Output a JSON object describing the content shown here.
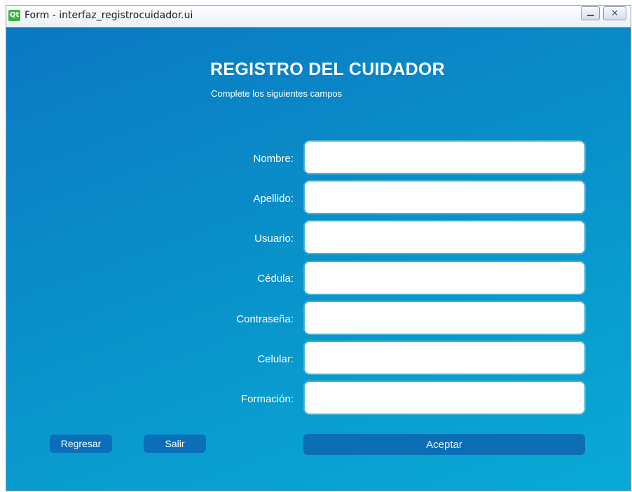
{
  "window": {
    "app_icon": "Qt",
    "title": "Form - interfaz_registrocuidador.ui"
  },
  "form": {
    "heading": "REGISTRO DEL CUIDADOR",
    "subheading": "Complete los siguientes campos",
    "fields": [
      {
        "label": "Nombre:",
        "value": ""
      },
      {
        "label": "Apellido:",
        "value": ""
      },
      {
        "label": "Usuario:",
        "value": ""
      },
      {
        "label": "Cédula:",
        "value": ""
      },
      {
        "label": "Contraseña:",
        "value": ""
      },
      {
        "label": "Celular:",
        "value": ""
      },
      {
        "label": "Formación:",
        "value": ""
      }
    ]
  },
  "buttons": {
    "regresar": "Regresar",
    "salir": "Salir",
    "aceptar": "Aceptar"
  },
  "colors": {
    "background_start": "#0b78c3",
    "background_end": "#09aad6",
    "button": "#0a6fb8"
  }
}
